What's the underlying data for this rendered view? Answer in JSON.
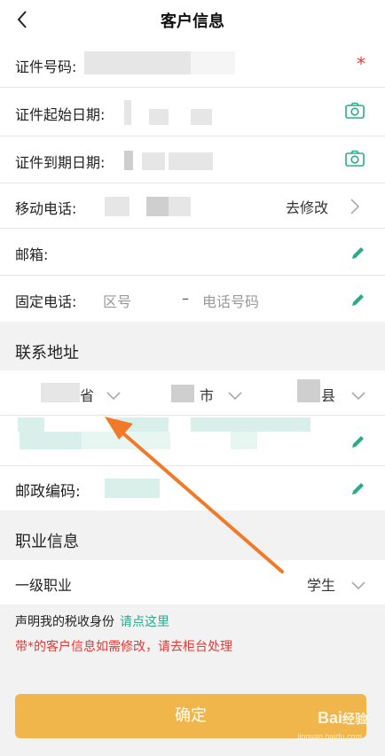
{
  "header": {
    "title": "客户信息"
  },
  "fields": {
    "id_number": {
      "label": "证件号码:",
      "required_mark": "*"
    },
    "id_start_date": {
      "label": "证件起始日期:"
    },
    "id_end_date": {
      "label": "证件到期日期:"
    },
    "mobile": {
      "label": "移动电话:",
      "action": "去修改"
    },
    "email": {
      "label": "邮箱:"
    },
    "landline": {
      "label": "固定电话:",
      "area_placeholder": "区号",
      "separator": "–",
      "number_placeholder": "电话号码"
    }
  },
  "contact_address": {
    "title": "联系地址",
    "province_suffix": "省",
    "city_suffix": "市",
    "county_suffix": "县",
    "postal_code_label": "邮政编码:"
  },
  "occupation": {
    "title": "职业信息",
    "level1_label": "一级职业",
    "level1_value": "学生"
  },
  "notices": {
    "tax_prefix": "声明我的税收身份",
    "tax_link": "请点这里",
    "warning": "带*的客户信息如需修改，请去柜台处理"
  },
  "confirm_button": "确定",
  "colors": {
    "accent_green": "#2bab8c",
    "required_red": "#e53935",
    "button_orange": "#f0b64b",
    "annotation_arrow": "#f07a2a"
  }
}
